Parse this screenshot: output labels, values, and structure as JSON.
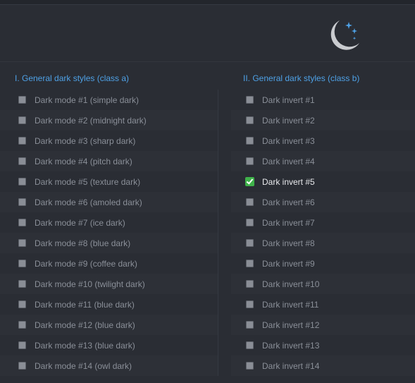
{
  "colors": {
    "background": "#2a2d34",
    "accent": "#4ea1e6",
    "checked": "#3fb24a"
  },
  "header": {
    "icon": "moon-stars-icon"
  },
  "class_a": {
    "title": "I. General dark styles (class a)",
    "items": [
      {
        "label": "Dark mode #1 (simple dark)",
        "checked": false
      },
      {
        "label": "Dark mode #2 (midnight dark)",
        "checked": false
      },
      {
        "label": "Dark mode #3 (sharp dark)",
        "checked": false
      },
      {
        "label": "Dark mode #4 (pitch dark)",
        "checked": false
      },
      {
        "label": "Dark mode #5 (texture dark)",
        "checked": false
      },
      {
        "label": "Dark mode #6 (amoled dark)",
        "checked": false
      },
      {
        "label": "Dark mode #7 (ice dark)",
        "checked": false
      },
      {
        "label": "Dark mode #8 (blue dark)",
        "checked": false
      },
      {
        "label": "Dark mode #9 (coffee dark)",
        "checked": false
      },
      {
        "label": "Dark mode #10 (twilight dark)",
        "checked": false
      },
      {
        "label": "Dark mode #11 (blue dark)",
        "checked": false
      },
      {
        "label": "Dark mode #12 (blue dark)",
        "checked": false
      },
      {
        "label": "Dark mode #13 (blue dark)",
        "checked": false
      },
      {
        "label": "Dark mode #14 (owl dark)",
        "checked": false
      }
    ]
  },
  "class_b": {
    "title": "II. General dark styles (class b)",
    "items": [
      {
        "label": "Dark invert #1",
        "checked": false
      },
      {
        "label": "Dark invert #2",
        "checked": false
      },
      {
        "label": "Dark invert #3",
        "checked": false
      },
      {
        "label": "Dark invert #4",
        "checked": false
      },
      {
        "label": "Dark invert #5",
        "checked": true
      },
      {
        "label": "Dark invert #6",
        "checked": false
      },
      {
        "label": "Dark invert #7",
        "checked": false
      },
      {
        "label": "Dark invert #8",
        "checked": false
      },
      {
        "label": "Dark invert #9",
        "checked": false
      },
      {
        "label": "Dark invert #10",
        "checked": false
      },
      {
        "label": "Dark invert #11",
        "checked": false
      },
      {
        "label": "Dark invert #12",
        "checked": false
      },
      {
        "label": "Dark invert #13",
        "checked": false
      },
      {
        "label": "Dark invert #14",
        "checked": false
      }
    ]
  }
}
